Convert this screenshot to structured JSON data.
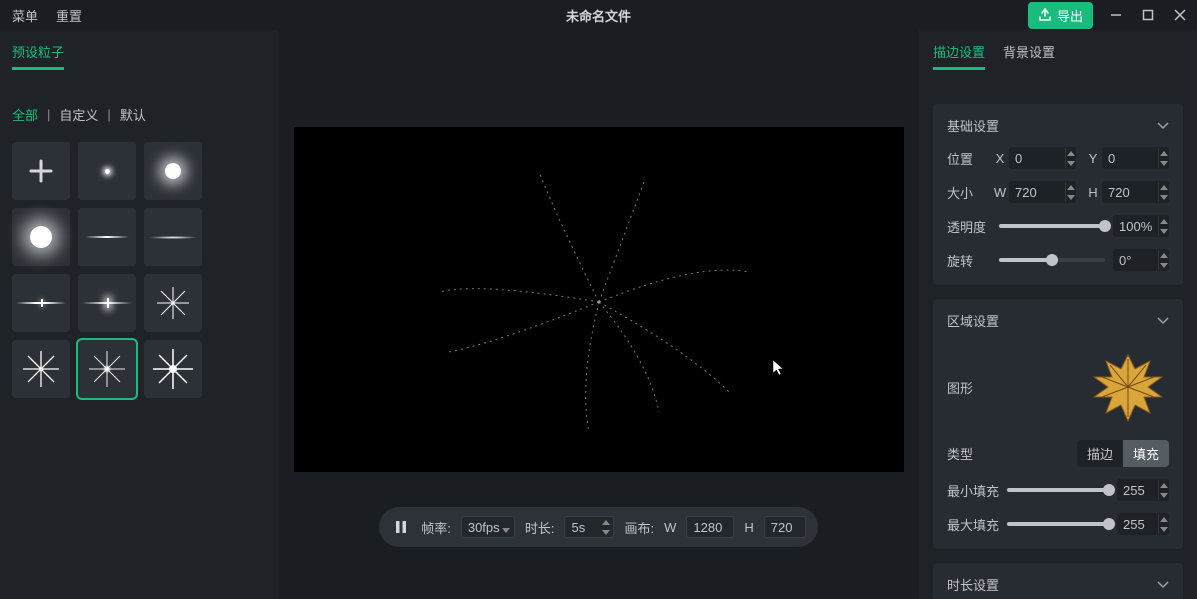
{
  "titlebar": {
    "menu": "菜单",
    "reset": "重置",
    "title": "未命名文件",
    "export": "导出"
  },
  "left": {
    "tab_preset": "预设粒子",
    "filters": {
      "all": "全部",
      "custom": "自定义",
      "default": "默认"
    }
  },
  "bottom": {
    "rate_label": "帧率:",
    "rate_value": "30fps",
    "dur_label": "时长:",
    "dur_value": "5s",
    "canvas_label": "画布:",
    "w_label": "W",
    "w_value": "1280",
    "h_label": "H",
    "h_value": "720"
  },
  "right": {
    "tab_stroke": "描边设置",
    "tab_bg": "背景设置",
    "sec_basic": "基础设置",
    "sec_area": "区域设置",
    "sec_dur": "时长设置",
    "pos": "位置",
    "x": "X",
    "x_val": "0",
    "y": "Y",
    "y_val": "0",
    "size": "大小",
    "w": "W",
    "w_val": "720",
    "h": "H",
    "h_val": "720",
    "opacity": "透明度",
    "opacity_val": "100%",
    "rotate": "旋转",
    "rotate_val": "0°",
    "shape": "图形",
    "type": "类型",
    "type_stroke": "描边",
    "type_fill": "填充",
    "min_fill": "最小填充",
    "min_fill_val": "255",
    "max_fill": "最大填充",
    "max_fill_val": "255"
  }
}
